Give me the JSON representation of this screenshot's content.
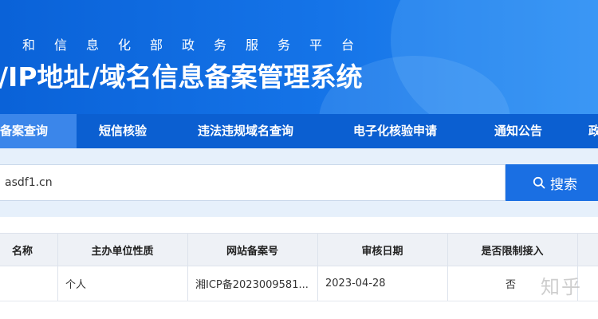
{
  "banner": {
    "subtitle": "和信息化部政务服务平台",
    "title": "/IP地址/域名信息备案管理系统"
  },
  "nav": {
    "items": [
      {
        "label": "备案查询"
      },
      {
        "label": "短信核验"
      },
      {
        "label": "违法违规域名查询"
      },
      {
        "label": "电子化核验申请"
      },
      {
        "label": "通知公告"
      },
      {
        "label": "政"
      }
    ]
  },
  "search": {
    "value": "asdf1.cn",
    "button_label": "搜索"
  },
  "table": {
    "headers": [
      "名称",
      "主办单位性质",
      "网站备案号",
      "审核日期",
      "是否限制接入"
    ],
    "rows": [
      {
        "name": "",
        "type": "个人",
        "icp": "湘ICP备2023009581...",
        "date": "2023-04-28",
        "restricted": "否"
      }
    ]
  },
  "watermark": "知乎",
  "colors": {
    "banner": "#1574e8",
    "nav": "#0b5fd1",
    "nav_active": "#3b86ea",
    "search_button": "#1a6fe3",
    "search_area": "#e6f0fb",
    "table_header": "#eef1f6"
  }
}
